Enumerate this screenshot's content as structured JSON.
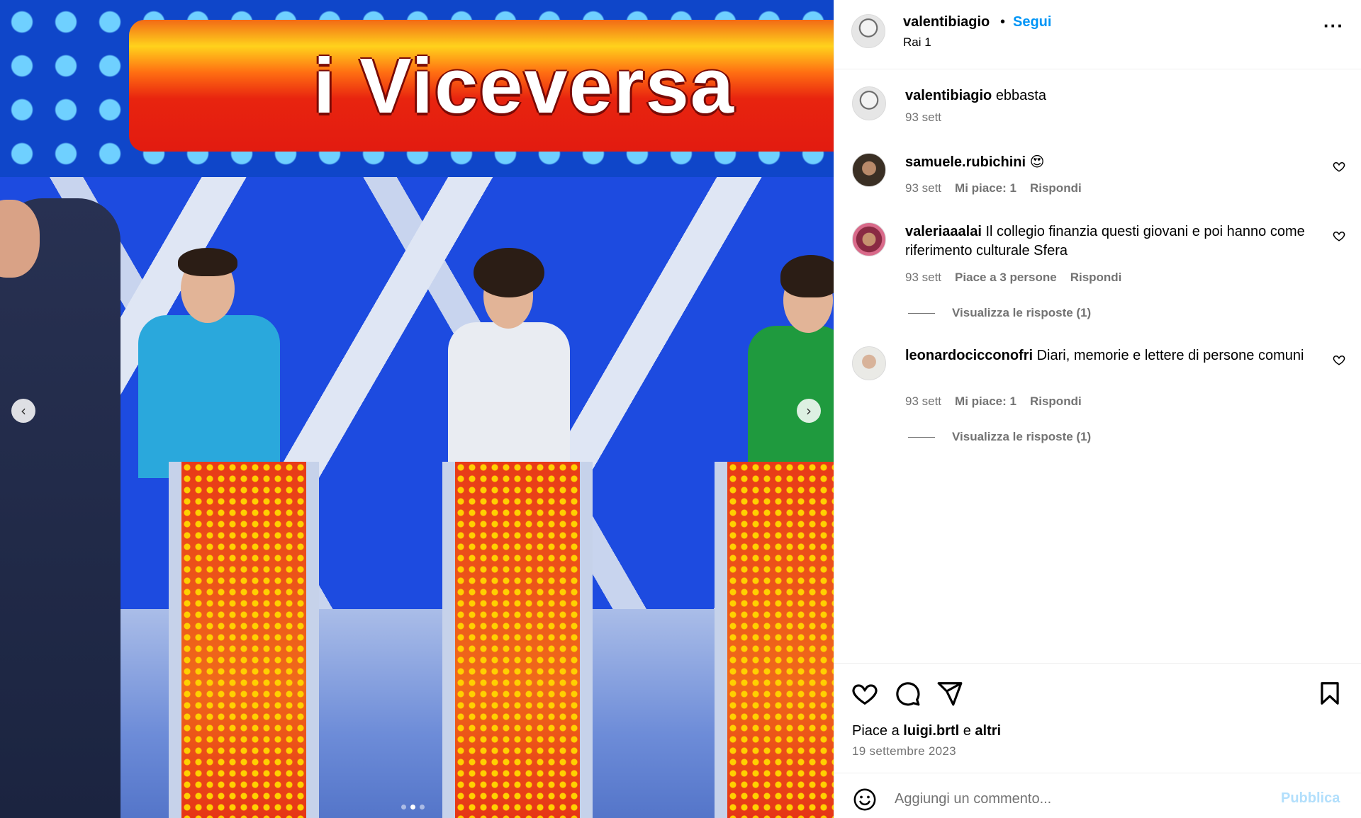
{
  "media": {
    "banner_text": "i Viceversa",
    "carousel_total": 3,
    "carousel_active": 2,
    "prev_icon": "chevron-left-icon",
    "next_icon": "chevron-right-icon"
  },
  "header": {
    "username": "valentibiagio",
    "separator": "•",
    "follow_label": "Segui",
    "location": "Rai 1",
    "more_icon": "more-horizontal-icon",
    "more_glyph": "···"
  },
  "comments": [
    {
      "username": "valentibiagio",
      "text": "ebbasta",
      "time": "93 sett"
    },
    {
      "username": "samuele.rubichini",
      "text": "😍",
      "time": "93 sett",
      "likes": "Mi piace: 1",
      "reply": "Rispondi"
    },
    {
      "username": "valeriaaalai",
      "text": "Il collegio finanzia questi giovani e poi hanno come riferimento culturale Sfera",
      "time": "93 sett",
      "likes": "Piace a 3 persone",
      "reply": "Rispondi",
      "view_replies": "Visualizza le risposte (1)"
    },
    {
      "username": "leonardocicconofri",
      "text": "Diari, memorie e lettere di persone comuni",
      "time": "93 sett",
      "likes": "Mi piace: 1",
      "reply": "Rispondi",
      "view_replies": "Visualizza le risposte (1)"
    }
  ],
  "actions": {
    "like_icon": "heart-icon",
    "comment_icon": "comment-icon",
    "share_icon": "send-icon",
    "save_icon": "bookmark-icon",
    "likes_prefix": "Piace a",
    "likes_user": "luigi.brtl",
    "likes_conj": "e",
    "likes_others": "altri",
    "date": "19 settembre 2023"
  },
  "composer": {
    "emoji_icon": "emoji-icon",
    "placeholder": "Aggiungi un commento...",
    "publish_label": "Pubblica"
  },
  "colors": {
    "accent": "#0095f6",
    "muted": "#737373",
    "publish_disabled": "#b2dffc"
  }
}
